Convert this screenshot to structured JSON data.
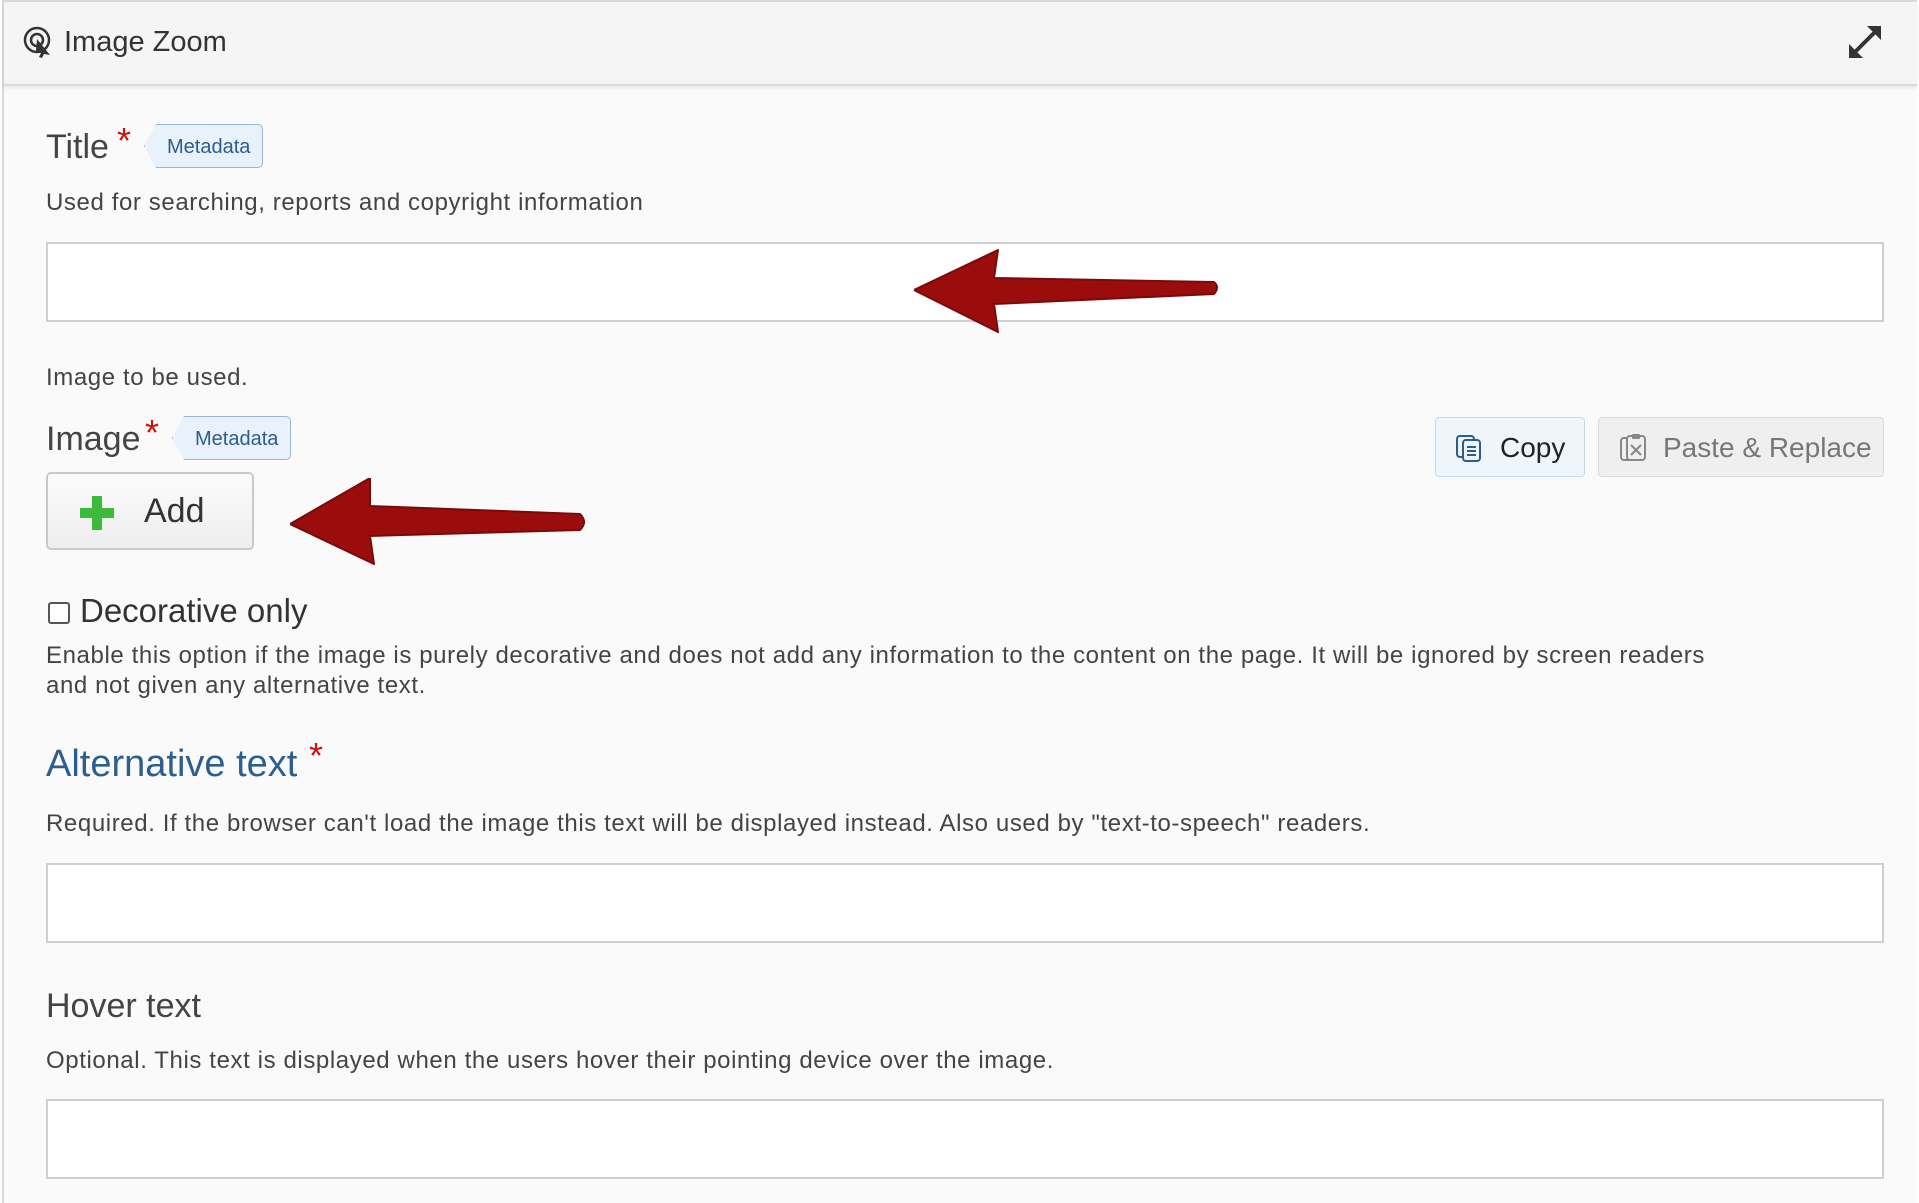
{
  "header": {
    "title": "Image Zoom",
    "icon": "pointer-click-icon",
    "expand_icon": "expand-arrows-icon"
  },
  "title_field": {
    "label": "Title",
    "required_marker": "*",
    "tag": "Metadata",
    "description": "Used for searching, reports and copyright information",
    "value": ""
  },
  "image_field": {
    "description": "Image to be used.",
    "label": "Image",
    "required_marker": "*",
    "tag": "Metadata",
    "add_label": "Add",
    "copy_label": "Copy",
    "paste_label": "Paste & Replace"
  },
  "decorative": {
    "label": "Decorative only",
    "checked": false,
    "description_line1": "Enable this option if the image is purely decorative and does not add any information to the content on the page. It will be ignored by screen readers",
    "description_line2": "and not given any alternative text."
  },
  "alt_text": {
    "label": "Alternative text",
    "required_marker": "*",
    "description": "Required. If the browser can't load the image this text will be displayed instead. Also used by \"text-to-speech\" readers.",
    "value": ""
  },
  "hover_text": {
    "label": "Hover text",
    "description": "Optional. This text is displayed when the users hover their pointing device over the image.",
    "value": ""
  },
  "colors": {
    "required": "#cc1111",
    "link_blue": "#2c5e8f",
    "arrow_red": "#9b0d0d",
    "add_green": "#3cba3c"
  }
}
